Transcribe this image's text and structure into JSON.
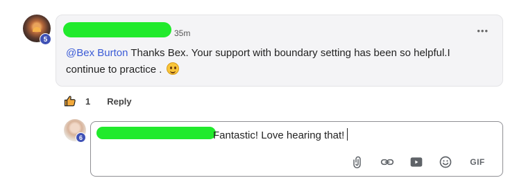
{
  "comment": {
    "author_name": "",
    "author_level": "5",
    "timestamp": "35m",
    "more_icon": "more-horizontal-icon",
    "mention": "@Bex Burton",
    "body": " Thanks Bex. Your support with boundary setting has been so helpful.I continue to practice ."
  },
  "actions": {
    "like_icon": "thumbs-up-icon",
    "like_count": "1",
    "reply_label": "Reply"
  },
  "composer": {
    "user_level": "6",
    "text": "Fantastic! Love hearing that!",
    "tools": [
      "attachment-icon",
      "link-icon",
      "video-icon",
      "emoji-icon",
      "gif-icon"
    ],
    "gif_label": "GIF"
  },
  "colors": {
    "accent": "#3b5bd6",
    "badge": "#3f51b5",
    "redaction": "#21ea2c"
  }
}
